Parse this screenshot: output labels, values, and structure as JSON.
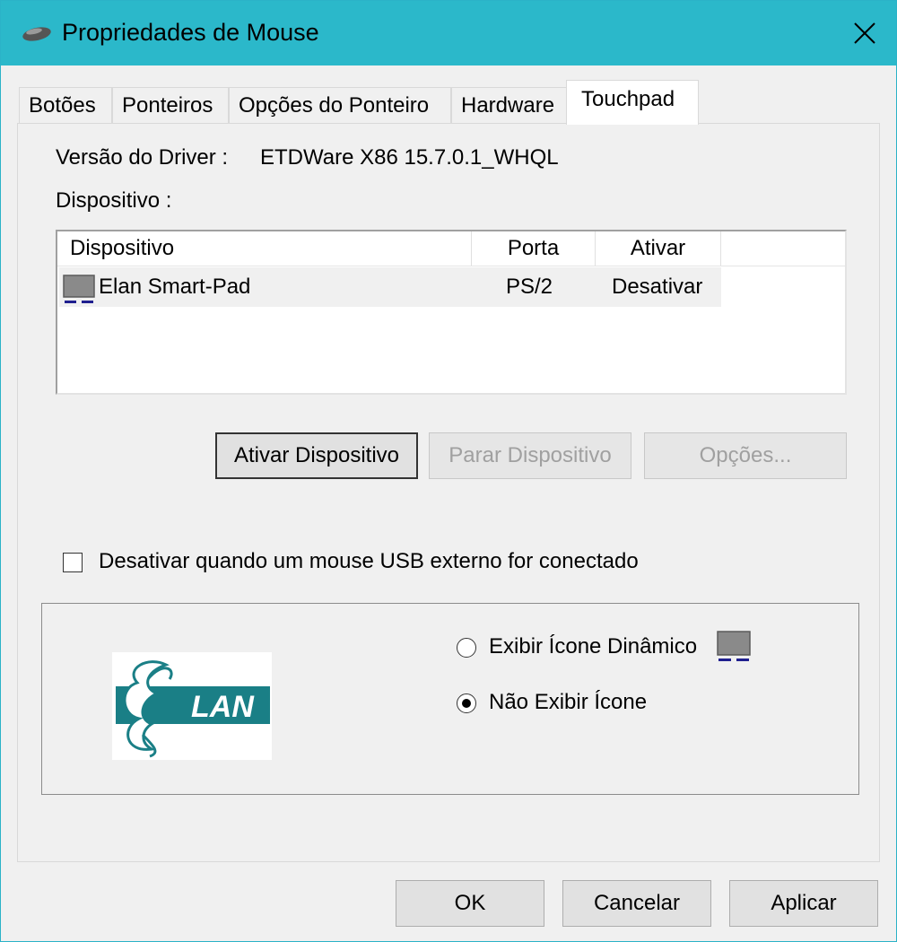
{
  "window": {
    "title": "Propriedades de Mouse",
    "title_icon": "mouse-icon",
    "close_icon": "close-icon"
  },
  "tabs": [
    {
      "label": "Botões",
      "active": false
    },
    {
      "label": "Ponteiros",
      "active": false
    },
    {
      "label": "Opções do Ponteiro",
      "active": false
    },
    {
      "label": "Hardware",
      "active": false
    },
    {
      "label": "Touchpad",
      "active": true
    }
  ],
  "touchpad": {
    "driver_label": "Versão do Driver :",
    "driver_value": "ETDWare X86 15.7.0.1_WHQL",
    "device_label": "Dispositivo :",
    "table": {
      "columns": [
        "Dispositivo",
        "Porta",
        "Ativar"
      ],
      "rows": [
        {
          "device": "Elan Smart-Pad",
          "port": "PS/2",
          "enable": "Desativar",
          "icon": "touchpad-icon"
        }
      ]
    },
    "buttons": {
      "activate": "Ativar Dispositivo",
      "stop": "Parar Dispositivo",
      "options": "Opções..."
    },
    "disable_checkbox": {
      "label": "Desativar quando um mouse USB externo for conectado",
      "checked": false
    },
    "logo_text": "LAN",
    "radios": [
      {
        "label": "Exibir Ícone Dinâmico",
        "checked": false
      },
      {
        "label": "Não Exibir Ícone",
        "checked": true
      }
    ]
  },
  "footer": {
    "ok": "OK",
    "cancel": "Cancelar",
    "apply": "Aplicar"
  },
  "colors": {
    "titlebar": "#2bb8ca",
    "logo_teal": "#1a7f86",
    "icon_gray": "#7a7a7a",
    "icon_blue": "#1f1f8f"
  }
}
